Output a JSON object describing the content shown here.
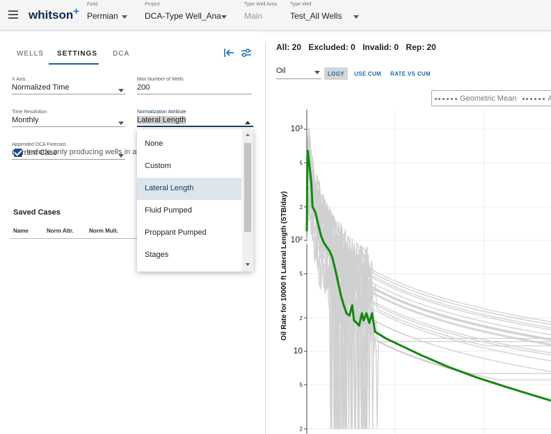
{
  "topbar": {
    "logo": "whitson",
    "logo_plus": "+",
    "field": {
      "label": "Field",
      "value": "Permian"
    },
    "project": {
      "label": "Project",
      "value": "DCA-Type Well_Ana"
    },
    "type_well_area": {
      "label": "Type Well Area",
      "value": "Main"
    },
    "type_well": {
      "label": "Type Well",
      "value": "Test_All Wells"
    }
  },
  "tabs": [
    "WELLS",
    "SETTINGS",
    "DCA"
  ],
  "settings": {
    "x_axis": {
      "label": "X Axis",
      "value": "Normalized Time"
    },
    "max_wells": {
      "label": "Max Number of Wells",
      "value": "200"
    },
    "time_resolution": {
      "label": "Time Resolution",
      "value": "Monthly"
    },
    "normalization_attribute": {
      "label": "Normalization Attribute",
      "value": "Lateral Length"
    },
    "appended_forecast": {
      "label": "Appended DCA Forecast",
      "value": "Current Case"
    },
    "include_producing": "Include only producing wells in av"
  },
  "dropdown": {
    "options": [
      "None",
      "Custom",
      "Lateral Length",
      "Fluid Pumped",
      "Proppant Pumped",
      "Stages"
    ],
    "selected_index": 2
  },
  "saved_cases": {
    "title": "Saved Cases",
    "columns": [
      "Name",
      "Norm Attr.",
      "Norm Mult."
    ]
  },
  "counts": {
    "all": "All: 20",
    "excluded": "Excluded: 0",
    "invalid": "Invalid: 0",
    "rep": "Rep: 20"
  },
  "toolbar": {
    "phase": "Oil",
    "logy": "LOGY",
    "use_cum": "USE CUM",
    "rate_vs_cum": "RATE VS CUM"
  },
  "legend": {
    "item1": "Geometric Mean",
    "item2": "A"
  },
  "chart_data": {
    "type": "line",
    "ylabel": "Oil Rate for 10000 ft Lateral Length (STB/day)",
    "yscale": "log",
    "ylim": [
      1.8,
      1500
    ],
    "y_tick_labels": [
      "10³",
      "5",
      "2",
      "10²",
      "5",
      "2",
      "10",
      "5",
      "2"
    ],
    "grid": true,
    "series": [
      {
        "name": "Geometric Mean",
        "color": "#118811",
        "points": [
          [
            0,
            120
          ],
          [
            1,
            600
          ],
          [
            2,
            640
          ],
          [
            3,
            560
          ],
          [
            5,
            450
          ],
          [
            8,
            330
          ],
          [
            10,
            200
          ],
          [
            15,
            180
          ],
          [
            20,
            140
          ],
          [
            25,
            110
          ],
          [
            30,
            95
          ],
          [
            40,
            80
          ],
          [
            45,
            70
          ],
          [
            50,
            55
          ],
          [
            55,
            42
          ],
          [
            60,
            32
          ],
          [
            65,
            26
          ],
          [
            70,
            22
          ],
          [
            75,
            21
          ],
          [
            80,
            26
          ],
          [
            83,
            19
          ],
          [
            88,
            18
          ],
          [
            92,
            17
          ],
          [
            97,
            22
          ],
          [
            100,
            19
          ],
          [
            105,
            22
          ],
          [
            110,
            18
          ],
          [
            115,
            22
          ],
          [
            120,
            15
          ],
          [
            140,
            13
          ],
          [
            170,
            11
          ],
          [
            200,
            9.3
          ],
          [
            250,
            7.2
          ],
          [
            300,
            5.8
          ],
          [
            350,
            4.8
          ],
          [
            400,
            4.0
          ],
          [
            430,
            3.6
          ]
        ]
      }
    ],
    "background_series_color": "#d0d0d0"
  }
}
